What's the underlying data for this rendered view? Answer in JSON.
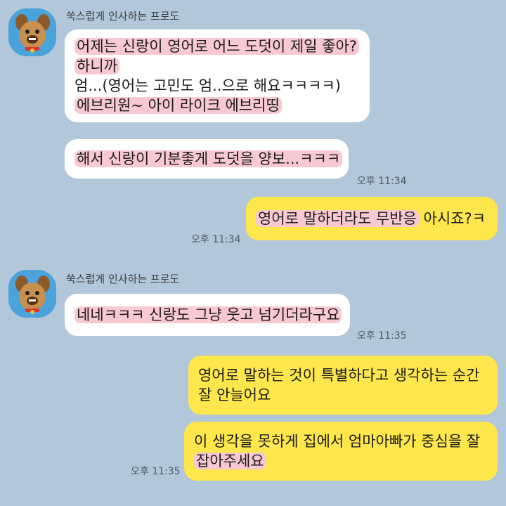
{
  "colors": {
    "background": "#b2c7d9",
    "incoming_bubble": "#ffffff",
    "outgoing_bubble": "#fde74d",
    "highlight": "#f8c8d3"
  },
  "groups": [
    {
      "sender": "쑥스럽게 인사하는 프로도",
      "avatar_icon": "frodo-dog-avatar"
    },
    {
      "sender": "쑥스럽게 인사하는 프로도",
      "avatar_icon": "frodo-dog-avatar"
    }
  ],
  "messages": [
    {
      "direction": "incoming",
      "lines": [
        "어제는 신랑이 영어로 어느 도덧이 제일 좋아?",
        "하니까",
        "엄...(영어는 고민도 엄..으로 해요ㅋㅋㅋㅋ)",
        "에브리원~ 아이 라이크 에브리띵"
      ]
    },
    {
      "direction": "incoming",
      "lines": [
        "해서 신랑이 기분좋게 도덧을 양보...ㅋㅋㅋ"
      ],
      "time": "오후 11:34"
    },
    {
      "direction": "outgoing",
      "segments": [
        "영어로 말하더라도 무반응",
        " 아시죠?ㅋ"
      ],
      "time": "오후 11:34"
    },
    {
      "direction": "incoming",
      "lines": [
        "네네ㅋㅋㅋ 신랑도 그냥 웃고 넘기더라구요"
      ],
      "time": "오후 11:35"
    },
    {
      "direction": "outgoing",
      "lines": [
        "영어로 말하는 것이 특별하다고 생각하는 순간",
        "잘 안늘어요"
      ]
    },
    {
      "direction": "outgoing",
      "lines": [
        "이 생각을 못하게 집에서 엄마아빠가 중심을 잘",
        "잡아주세요"
      ],
      "time": "오후 11:35"
    }
  ]
}
